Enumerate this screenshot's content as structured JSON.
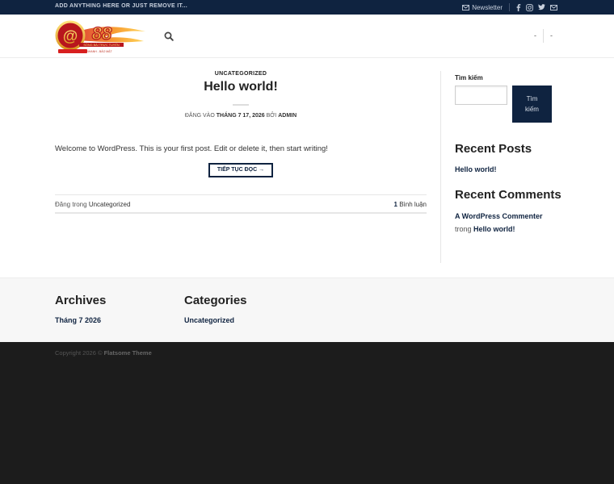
{
  "topbar": {
    "tagline": "ADD ANYTHING HERE OR JUST REMOVE IT...",
    "newsletter_label": "Newsletter",
    "social_icons": [
      "facebook-icon",
      "instagram-icon",
      "twitter-icon",
      "email-icon"
    ]
  },
  "header": {
    "logo_text": "88",
    "logo_subtext": "SÒNG BÀI TRỰC TUYẾN",
    "nav_right": [
      "-",
      "-"
    ]
  },
  "post": {
    "category": "UNCATEGORIZED",
    "title": "Hello world!",
    "meta_prefix": "ĐĂNG VÀO",
    "meta_date": "THÁNG 7 17, 2026",
    "meta_by": "BỞI",
    "meta_author": "ADMIN",
    "excerpt": "Welcome to WordPress. This is your first post. Edit or delete it, then start writing!",
    "read_more": "TIẾP TỤC ĐỌC →",
    "footer_prefix": "Đăng trong",
    "footer_category": "Uncategorized",
    "comment_count": "1",
    "comment_label": "Bình luận"
  },
  "sidebar": {
    "search_label": "Tìm kiếm",
    "search_button": "Tìm kiếm",
    "recent_posts_title": "Recent Posts",
    "recent_posts": [
      "Hello world!"
    ],
    "recent_comments_title": "Recent Comments",
    "comment_author": "A WordPress Commenter",
    "comment_on": "trong",
    "comment_post": "Hello world!"
  },
  "footer_widgets": {
    "archives_title": "Archives",
    "archives": [
      "Tháng 7 2026"
    ],
    "categories_title": "Categories",
    "categories": [
      "Uncategorized"
    ]
  },
  "footer": {
    "copyright_prefix": "Copyright 2026 ©",
    "theme": "Flatsome Theme"
  },
  "colors": {
    "primary": "#0f2340",
    "footer_bg": "#1c1c1c",
    "widgets_bg": "#f7f7f7"
  }
}
